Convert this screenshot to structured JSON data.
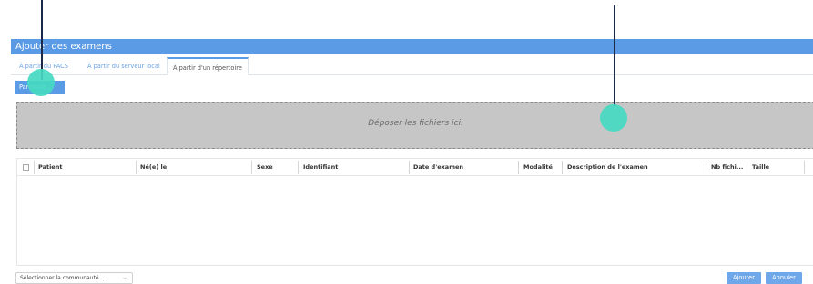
{
  "dialog": {
    "title": "Ajouter des examens",
    "tabs": [
      {
        "label": "À partir du PACS",
        "active": false
      },
      {
        "label": "À partir du serveur local",
        "active": false
      },
      {
        "label": "À partir d'un répertoire",
        "active": true
      }
    ],
    "browse_label": "Parcourir...",
    "dropzone_text": "Déposer les fichiers ici.",
    "table": {
      "columns": [
        "Patient",
        "Né(e) le",
        "Sexe",
        "Identifiant",
        "Date d'examen",
        "Modalité",
        "Description de l'examen",
        "Nb fichi...",
        "Taille"
      ],
      "rows": []
    },
    "footer": {
      "community_select_value": "Sélectionner la communauté...",
      "add_label": "Ajouter",
      "cancel_label": "Annuler"
    }
  },
  "colors": {
    "accent": "#5b9be6",
    "marker_line": "#1b2a4a",
    "marker_dot": "#47d9c2",
    "dropzone": "#c6c6c6"
  }
}
